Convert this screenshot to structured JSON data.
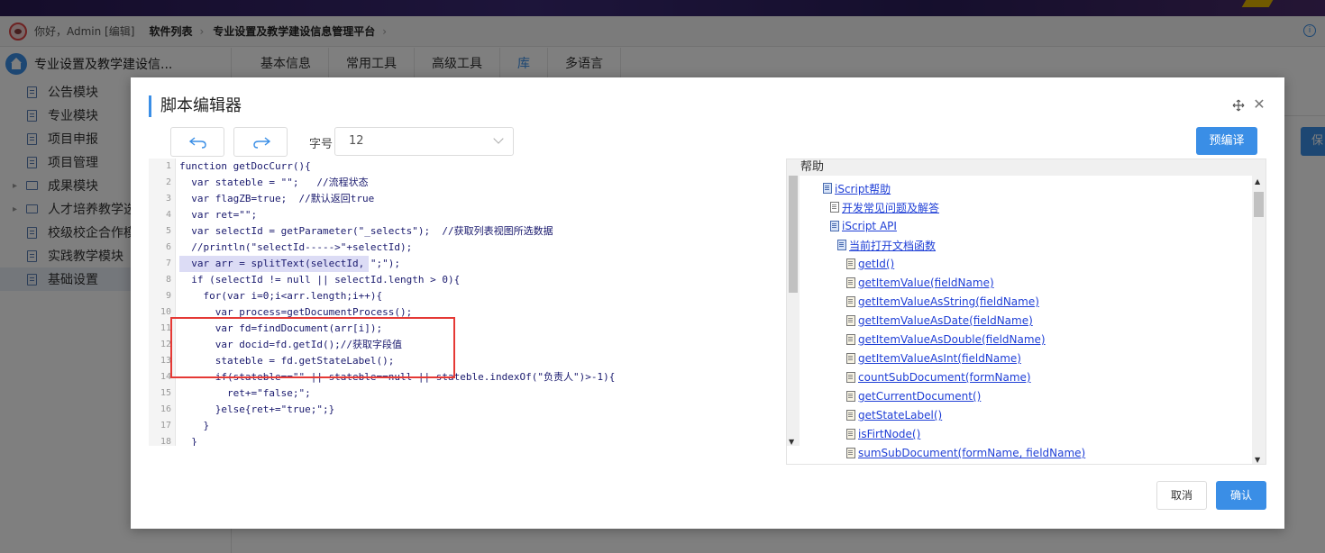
{
  "topbar": {
    "greeting": "你好，Admin [编辑]",
    "crumbs": [
      "软件列表",
      "专业设置及教学建设信息管理平台"
    ],
    "separator": "›"
  },
  "sidebar": {
    "title": "专业设置及教学建设信...",
    "items": [
      {
        "label": "公告模块",
        "type": "doc"
      },
      {
        "label": "专业模块",
        "type": "doc"
      },
      {
        "label": "项目申报",
        "type": "doc"
      },
      {
        "label": "项目管理",
        "type": "doc"
      },
      {
        "label": "成果模块",
        "type": "folder"
      },
      {
        "label": "人才培养教学选",
        "type": "folder"
      },
      {
        "label": "校级校企合作模",
        "type": "doc"
      },
      {
        "label": "实践教学模块",
        "type": "doc"
      },
      {
        "label": "基础设置",
        "type": "doc",
        "active": true
      }
    ]
  },
  "tabs": [
    "基本信息",
    "常用工具",
    "高级工具",
    "库",
    "多语言"
  ],
  "active_tab": "库",
  "background_save_label": "保",
  "dialog": {
    "title": "脚本编辑器",
    "font_label": "字号",
    "font_size": "12",
    "precompile_label": "预编译",
    "cancel_label": "取消",
    "ok_label": "确认",
    "code_lines": [
      {
        "n": "1",
        "text": "function getDocCurr(){"
      },
      {
        "n": "2",
        "text": "  var stateble = \"\";   //流程状态"
      },
      {
        "n": "3",
        "text": "  var flagZB=true;  //默认返回true"
      },
      {
        "n": "4",
        "text": "  var ret=\"\";"
      },
      {
        "n": "5",
        "text": "  var selectId = getParameter(\"_selects\");  //获取列表视图所选数据"
      },
      {
        "n": "6",
        "text": "  //println(\"selectId----->\"+selectId);"
      },
      {
        "n": "7",
        "text": "  var arr = splitText(selectId, \";\");"
      },
      {
        "n": "8",
        "text": "  if (selectId != null || selectId.length > 0){"
      },
      {
        "n": "9",
        "text": "    for(var i=0;i<arr.length;i++){"
      },
      {
        "n": "10",
        "text": "      var process=getDocumentProcess();"
      },
      {
        "n": "11",
        "text": "      var fd=findDocument(arr[i]);"
      },
      {
        "n": "12",
        "text": "      var docid=fd.getId();//获取字段值"
      },
      {
        "n": "13",
        "text": "      stateble = fd.getStateLabel();"
      },
      {
        "n": "14",
        "text": "      if(stateble==\"\" || stateble==null || stateble.indexOf(\"负责人\")>-1){"
      },
      {
        "n": "15",
        "text": "        ret+=\"false;\";"
      },
      {
        "n": "16",
        "text": "      }else{ret+=\"true;\";}"
      },
      {
        "n": "17",
        "text": "    }"
      },
      {
        "n": "18",
        "text": "  }"
      }
    ],
    "help": {
      "title": "帮助",
      "items": [
        {
          "label": "iScript帮助",
          "icon": "book"
        },
        {
          "label": "开发常见问题及解答",
          "icon": "page"
        },
        {
          "label": "iScript API",
          "icon": "book"
        },
        {
          "label": "当前打开文档函数",
          "icon": "book"
        },
        {
          "label": "getId()",
          "icon": "doc"
        },
        {
          "label": "getItemValue(fieldName)",
          "icon": "doc"
        },
        {
          "label": "getItemValueAsString(fieldName)",
          "icon": "doc"
        },
        {
          "label": "getItemValueAsDate(fieldName)",
          "icon": "doc"
        },
        {
          "label": "getItemValueAsDouble(fieldName)",
          "icon": "doc"
        },
        {
          "label": "getItemValueAsInt(fieldName)",
          "icon": "doc"
        },
        {
          "label": "countSubDocument(formName)",
          "icon": "doc"
        },
        {
          "label": "getCurrentDocument()",
          "icon": "doc"
        },
        {
          "label": "getStateLabel()",
          "icon": "doc"
        },
        {
          "label": "isFirtNode()",
          "icon": "doc"
        },
        {
          "label": "sumSubDocument(formName, fieldName)",
          "icon": "doc"
        }
      ]
    }
  },
  "colors": {
    "accent": "#3a8ee6",
    "highlight_border": "#e53935",
    "link": "#1f3fd6"
  }
}
